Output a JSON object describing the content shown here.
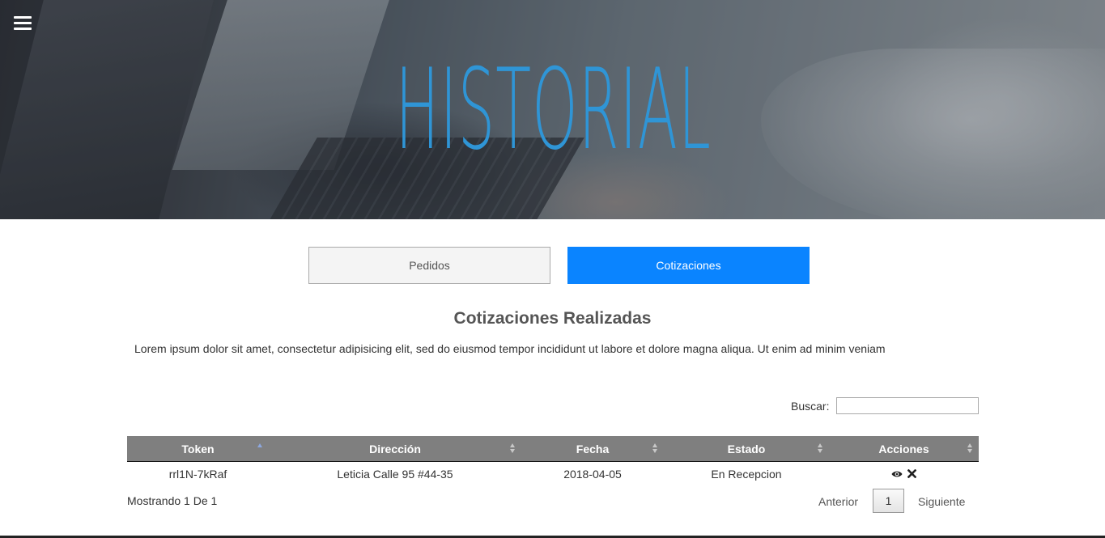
{
  "hero": {
    "title": "HISTORIAL"
  },
  "tabs": [
    {
      "label": "Pedidos",
      "active": false
    },
    {
      "label": "Cotizaciones",
      "active": true
    }
  ],
  "section": {
    "title": "Cotizaciones Realizadas",
    "description": "Lorem ipsum dolor sit amet, consectetur adipisicing elit, sed do eiusmod tempor incididunt ut labore et dolore magna aliqua. Ut enim ad minim veniam"
  },
  "search": {
    "label": "Buscar:",
    "value": ""
  },
  "table": {
    "columns": [
      "Token",
      "Dirección",
      "Fecha",
      "Estado",
      "Acciones"
    ],
    "rows": [
      {
        "token": "rrl1N-7kRaf",
        "direccion": "Leticia Calle 95 #44-35",
        "fecha": "2018-04-05",
        "estado": "En Recepcion",
        "actions": [
          "eye-icon",
          "close-icon"
        ]
      }
    ]
  },
  "footer": {
    "info": "Mostrando 1 De 1",
    "prev": "Anterior",
    "page": "1",
    "next": "Siguiente"
  },
  "colors": {
    "accent": "#0a84ff",
    "title_blue": "#2f95d6",
    "header_gray": "#7f7f7f"
  }
}
